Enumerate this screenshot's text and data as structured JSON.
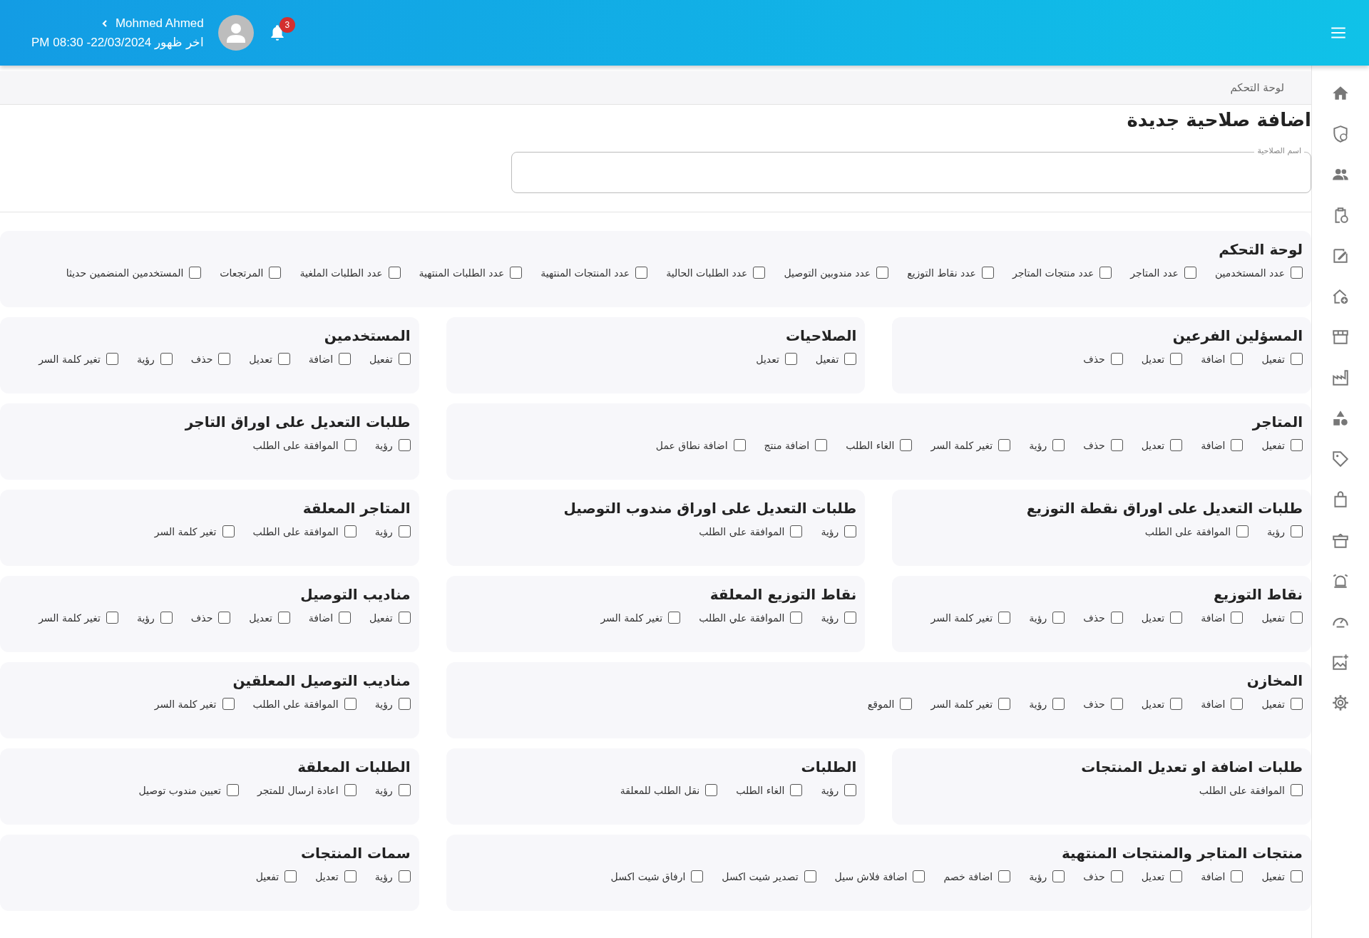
{
  "header": {
    "user_name": "Mohmed Ahmed",
    "last_seen": "اخر ظهور 22/03/2024- 08:30 PM",
    "notifications": "3"
  },
  "breadcrumb": "لوحة التحكم",
  "title": "اضافة صلاحية جديدة",
  "name_field": {
    "label": "اسم الصلاحية"
  },
  "sections": [
    {
      "title": "لوحة التحكم",
      "kind": "full",
      "permissions": [
        {
          "label": "عدد المستخدمين",
          "checked": false
        },
        {
          "label": "عدد المتاجر",
          "checked": false
        },
        {
          "label": "عدد منتجات المتاجر",
          "checked": false
        },
        {
          "label": "عدد نقاط التوزيع",
          "checked": false
        },
        {
          "label": "عدد مندوبين التوصيل",
          "checked": false
        },
        {
          "label": "عدد الطلبات الحالية",
          "checked": false
        },
        {
          "label": "عدد المنتجات المنتهية",
          "checked": false
        },
        {
          "label": "عدد الطلبات المنتهية",
          "checked": false
        },
        {
          "label": "عدد الطلبات الملغية",
          "checked": false
        },
        {
          "label": "المرتجعات",
          "checked": false
        },
        {
          "label": "المستخدمين المنضمين حديثا",
          "checked": false
        }
      ]
    },
    {
      "title": "المسؤلين الفرعين",
      "kind": "normal",
      "permissions": [
        {
          "label": "تفعيل",
          "checked": false
        },
        {
          "label": "اضافة",
          "checked": false
        },
        {
          "label": "تعديل",
          "checked": false
        },
        {
          "label": "حذف",
          "checked": false
        }
      ]
    },
    {
      "title": "الصلاحيات",
      "kind": "normal",
      "permissions": [
        {
          "label": "تفعيل",
          "checked": false
        },
        {
          "label": "تعديل",
          "checked": false
        }
      ]
    },
    {
      "title": "المستخدمين",
      "kind": "normal",
      "permissions": [
        {
          "label": "تفعيل",
          "checked": false
        },
        {
          "label": "اضافة",
          "checked": false
        },
        {
          "label": "تعديل",
          "checked": false
        },
        {
          "label": "حذف",
          "checked": false
        },
        {
          "label": "رؤية",
          "checked": false
        },
        {
          "label": "تغير كلمة السر",
          "checked": false
        }
      ]
    },
    {
      "title": "المتاجر",
      "kind": "wide",
      "permissions": [
        {
          "label": "تفعيل",
          "checked": false
        },
        {
          "label": "اضافة",
          "checked": false
        },
        {
          "label": "تعديل",
          "checked": false
        },
        {
          "label": "حذف",
          "checked": false
        },
        {
          "label": "رؤية",
          "checked": false
        },
        {
          "label": "تغير كلمة السر",
          "checked": false
        },
        {
          "label": "الغاء الطلب",
          "checked": false
        },
        {
          "label": "اضافة منتج",
          "checked": false
        },
        {
          "label": "اضافة نطاق عمل",
          "checked": false
        }
      ]
    },
    {
      "title": "طلبات التعديل على اوراق التاجر",
      "kind": "normal",
      "permissions": [
        {
          "label": "رؤية",
          "checked": false
        },
        {
          "label": "الموافقة على الطلب",
          "checked": false
        }
      ]
    },
    {
      "title": "طلبات التعديل على اوراق نقطة التوزيع",
      "kind": "normal",
      "permissions": [
        {
          "label": "رؤية",
          "checked": false
        },
        {
          "label": "الموافقة على الطلب",
          "checked": false
        }
      ]
    },
    {
      "title": "طلبات التعديل على اوراق مندوب التوصيل",
      "kind": "normal",
      "permissions": [
        {
          "label": "رؤية",
          "checked": false
        },
        {
          "label": "الموافقة على الطلب",
          "checked": false
        }
      ]
    },
    {
      "title": "المتاجر المعلقة",
      "kind": "normal",
      "permissions": [
        {
          "label": "رؤية",
          "checked": false
        },
        {
          "label": "الموافقة على الطلب",
          "checked": false
        },
        {
          "label": "تغير كلمة السر",
          "checked": false
        }
      ]
    },
    {
      "title": "نقاط التوزيع",
      "kind": "normal",
      "permissions": [
        {
          "label": "تفعيل",
          "checked": false
        },
        {
          "label": "اضافة",
          "checked": false
        },
        {
          "label": "تعديل",
          "checked": false
        },
        {
          "label": "حذف",
          "checked": false
        },
        {
          "label": "رؤية",
          "checked": false
        },
        {
          "label": "تغير كلمة السر",
          "checked": false
        }
      ]
    },
    {
      "title": "نقاط التوزيع المعلقة",
      "kind": "normal",
      "permissions": [
        {
          "label": "رؤية",
          "checked": false
        },
        {
          "label": "الموافقة علي الطلب",
          "checked": false
        },
        {
          "label": "تغير كلمة السر",
          "checked": false
        }
      ]
    },
    {
      "title": "مناديب التوصيل",
      "kind": "normal",
      "permissions": [
        {
          "label": "تفعيل",
          "checked": false
        },
        {
          "label": "اضافة",
          "checked": false
        },
        {
          "label": "تعديل",
          "checked": false
        },
        {
          "label": "حذف",
          "checked": false
        },
        {
          "label": "رؤية",
          "checked": false
        },
        {
          "label": "تغير كلمة السر",
          "checked": false
        }
      ]
    },
    {
      "title": "المخازن",
      "kind": "wide",
      "permissions": [
        {
          "label": "تفعيل",
          "checked": false
        },
        {
          "label": "اضافة",
          "checked": false
        },
        {
          "label": "تعديل",
          "checked": false
        },
        {
          "label": "حذف",
          "checked": false
        },
        {
          "label": "رؤية",
          "checked": false
        },
        {
          "label": "تغير كلمة السر",
          "checked": false
        },
        {
          "label": "الموقع",
          "checked": false
        }
      ]
    },
    {
      "title": "مناديب التوصيل المعلقين",
      "kind": "normal",
      "permissions": [
        {
          "label": "رؤية",
          "checked": false
        },
        {
          "label": "الموافقة علي الطلب",
          "checked": false
        },
        {
          "label": "تغير كلمة السر",
          "checked": false
        }
      ]
    },
    {
      "title": "طلبات اضافة او تعديل المنتجات",
      "kind": "normal",
      "permissions": [
        {
          "label": "الموافقة على الطلب",
          "checked": false
        }
      ]
    },
    {
      "title": "الطلبات",
      "kind": "normal",
      "permissions": [
        {
          "label": "رؤية",
          "checked": false
        },
        {
          "label": "الغاء الطلب",
          "checked": false
        },
        {
          "label": "نقل الطلب للمعلقة",
          "checked": false
        }
      ]
    },
    {
      "title": "الطلبات المعلقة",
      "kind": "normal",
      "permissions": [
        {
          "label": "رؤية",
          "checked": false
        },
        {
          "label": "اعادة ارسال للمتجر",
          "checked": false
        },
        {
          "label": "تعيين مندوب توصيل",
          "checked": false
        }
      ]
    },
    {
      "title": "منتجات المتاجر والمنتجات المنتهية",
      "kind": "wide",
      "permissions": [
        {
          "label": "تفعيل",
          "checked": false
        },
        {
          "label": "اضافة",
          "checked": false
        },
        {
          "label": "تعديل",
          "checked": false
        },
        {
          "label": "حذف",
          "checked": false
        },
        {
          "label": "رؤية",
          "checked": false
        },
        {
          "label": "اضافة خصم",
          "checked": false
        },
        {
          "label": "اضافة فلاش سيل",
          "checked": false
        },
        {
          "label": "تصدير شيت اكسل",
          "checked": false
        },
        {
          "label": "ارفاق شيت اكسل",
          "checked": false
        }
      ]
    },
    {
      "title": "سمات المنتجات",
      "kind": "normal",
      "permissions": [
        {
          "label": "رؤية",
          "checked": false
        },
        {
          "label": "تعديل",
          "checked": false
        },
        {
          "label": "تفعيل",
          "checked": false
        }
      ]
    }
  ]
}
